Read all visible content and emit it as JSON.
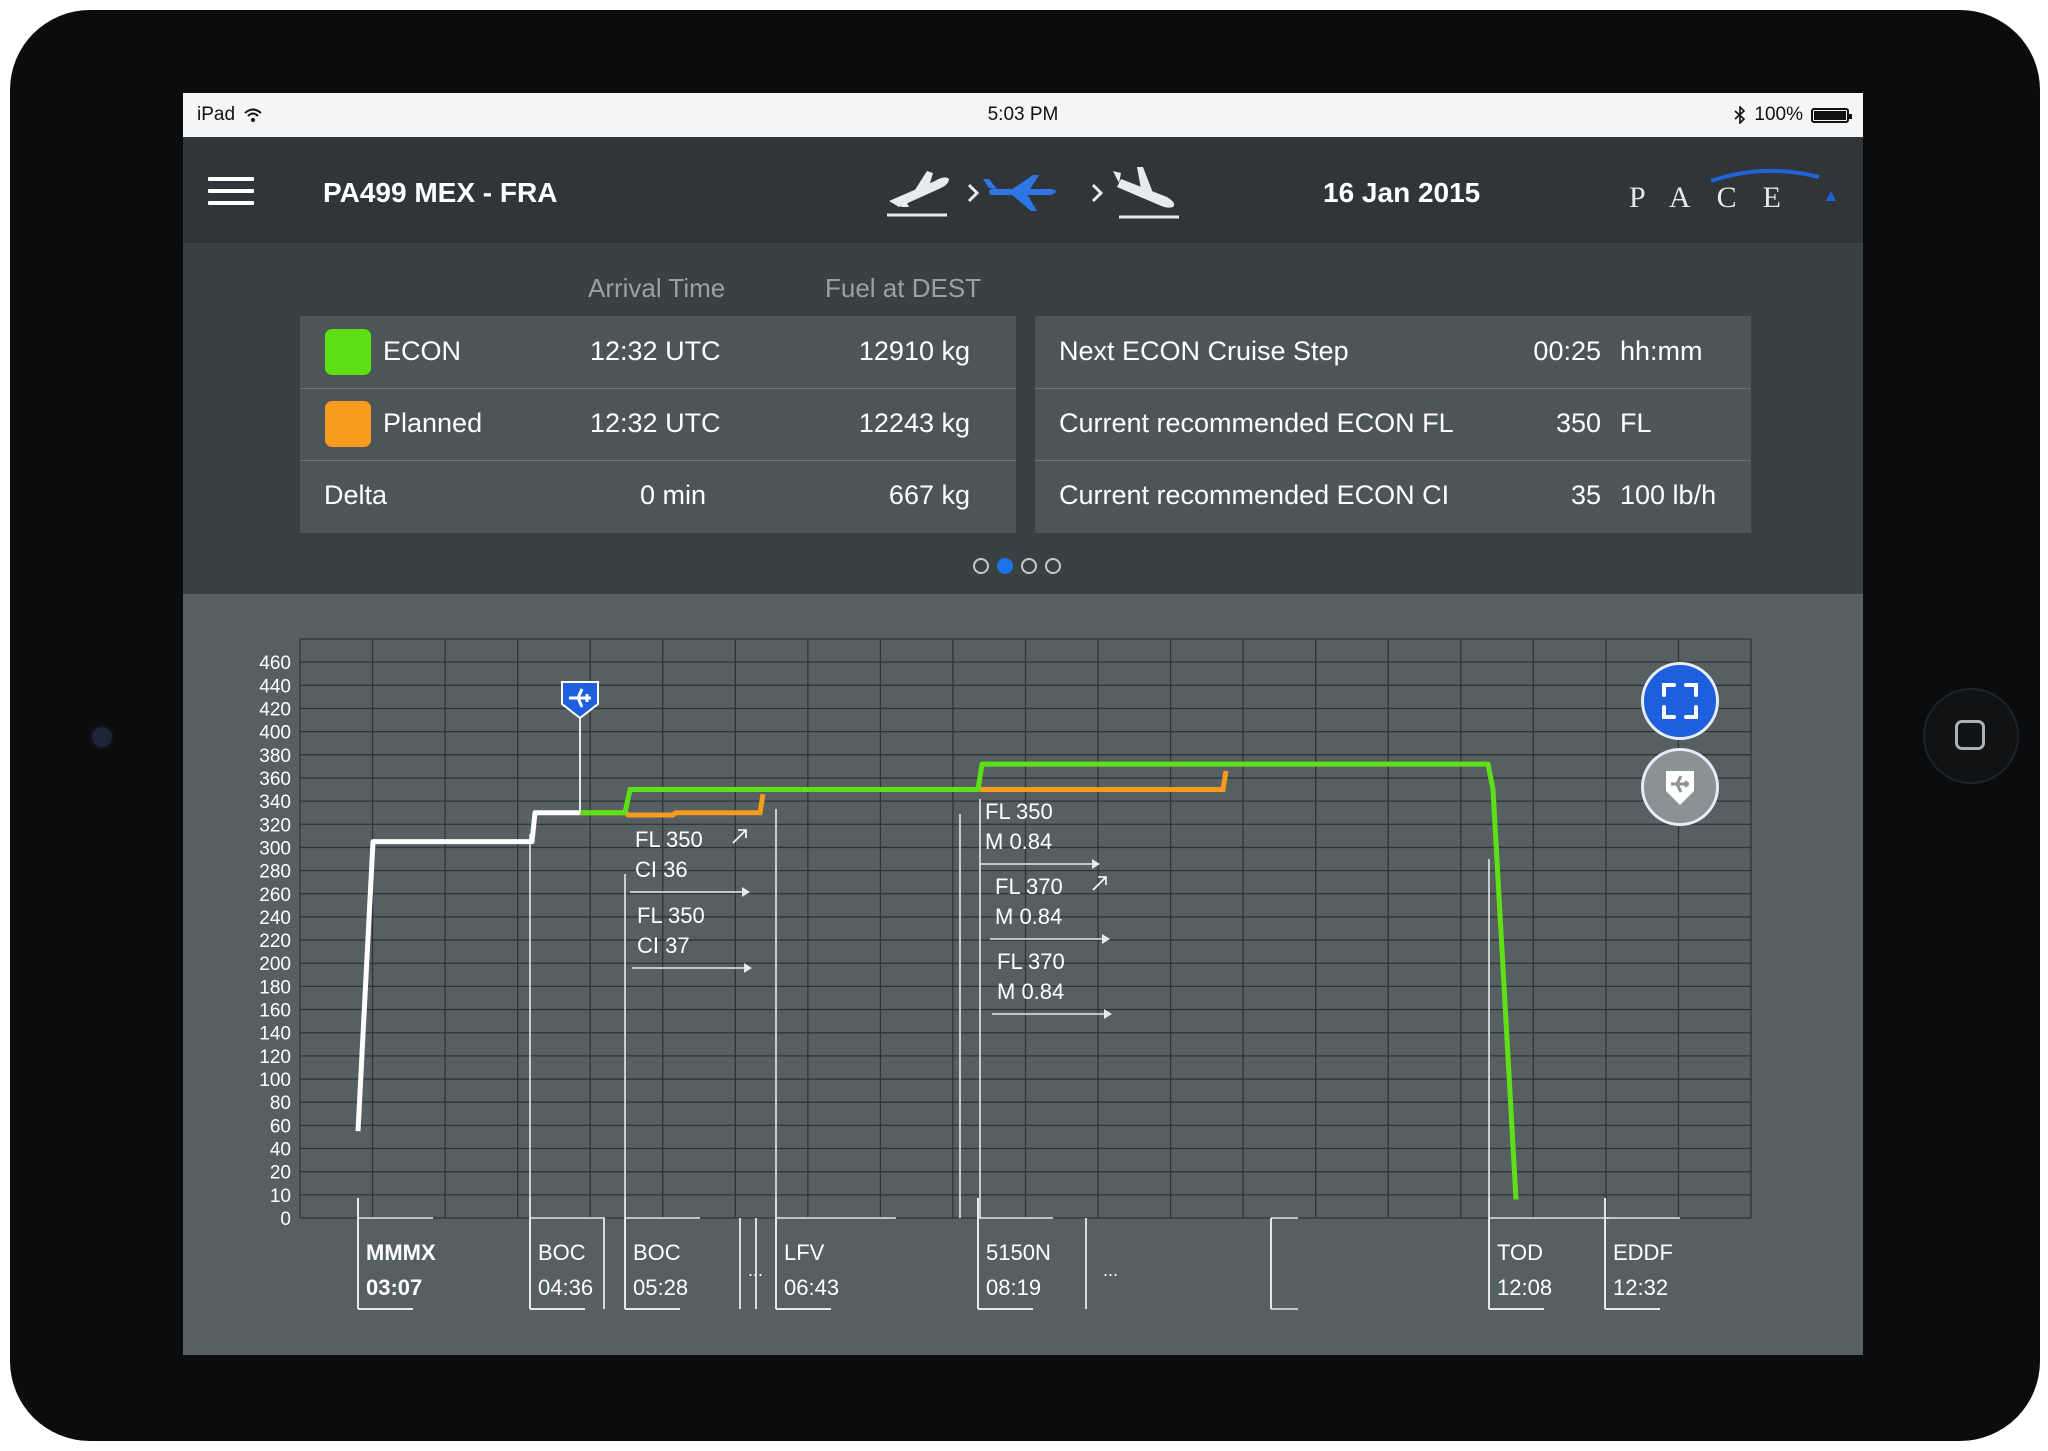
{
  "status_bar": {
    "device": "iPad",
    "time": "5:03 PM",
    "battery": "100%"
  },
  "header": {
    "flight": "PA499 MEX - FRA",
    "date": "16 Jan 2015",
    "logo": "PACE",
    "phases": [
      "takeoff-icon",
      "cruise-icon",
      "landing-icon"
    ],
    "active_phase": "cruise"
  },
  "summary": {
    "col_arrival": "Arrival Time",
    "col_fuel": "Fuel at DEST",
    "rows": [
      {
        "label": "ECON",
        "color": "#5ee016",
        "arrival": "12:32 UTC",
        "fuel": "12910 kg"
      },
      {
        "label": "Planned",
        "color": "#f79a1e",
        "arrival": "12:32 UTC",
        "fuel": "12243 kg"
      },
      {
        "label": "Delta",
        "arrival": "0 min",
        "fuel": "667 kg"
      }
    ]
  },
  "recommendations": {
    "rows": [
      {
        "label": "Next ECON Cruise Step",
        "value": "00:25",
        "unit": "hh:mm"
      },
      {
        "label": "Current recommended ECON FL",
        "value": "350",
        "unit": "FL"
      },
      {
        "label": "Current recommended ECON CI",
        "value": "35",
        "unit": "100 lb/h"
      }
    ]
  },
  "pager": {
    "count": 4,
    "active": 1
  },
  "chart_data": {
    "type": "line",
    "y_ticks": [
      0,
      10,
      20,
      40,
      60,
      80,
      100,
      120,
      140,
      160,
      180,
      200,
      220,
      240,
      260,
      280,
      300,
      320,
      340,
      360,
      380,
      400,
      420,
      440,
      460
    ],
    "colors": {
      "flown": "#ffffff",
      "econ": "#5ee016",
      "planned": "#f79a1e"
    },
    "waypoints": [
      {
        "name": "MMMX",
        "time": "03:07",
        "bold": true
      },
      {
        "name": "BOC",
        "time": "04:36"
      },
      {
        "name": "BOC",
        "time": "05:28"
      },
      {
        "name": "LFV",
        "time": "06:43"
      },
      {
        "name": "5150N",
        "time": "08:19"
      },
      {
        "name": "TOD",
        "time": "12:08"
      },
      {
        "name": "EDDF",
        "time": "12:32"
      }
    ],
    "ellipsis": "...",
    "annotations": [
      {
        "line1": "FL 350",
        "line2": "CI 36",
        "step": true
      },
      {
        "line1": "FL 350",
        "line2": "CI 37",
        "step": false
      },
      {
        "line1": "FL 350",
        "line2": "M 0.84",
        "step": false
      },
      {
        "line1": "FL 370",
        "line2": "M 0.84",
        "step": true
      },
      {
        "line1": "FL 370",
        "line2": "M 0.84",
        "step": false
      }
    ]
  }
}
